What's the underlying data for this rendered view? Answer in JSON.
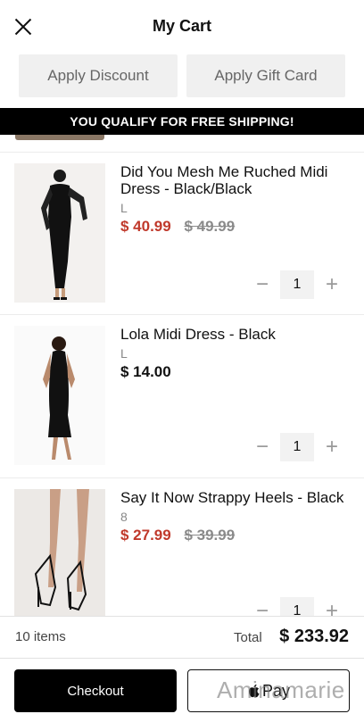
{
  "header": {
    "title": "My Cart"
  },
  "actions": {
    "discount_label": "Apply Discount",
    "gift_card_label": "Apply Gift Card"
  },
  "banner": {
    "text": "YOU QUALIFY FOR FREE SHIPPING!"
  },
  "items": [
    {
      "name": "Did You Mesh Me Ruched Midi Dress - Black/Black",
      "size": "L",
      "price": "$ 40.99",
      "original_price": "$ 49.99",
      "quantity": "1"
    },
    {
      "name": "Lola Midi Dress - Black",
      "size": "L",
      "price": "$ 14.00",
      "quantity": "1"
    },
    {
      "name": "Say It Now Strappy Heels - Black",
      "size": "8",
      "price": "$ 27.99",
      "original_price": "$ 39.99",
      "quantity": "1"
    }
  ],
  "qty_controls": {
    "minus": "−",
    "plus": "+"
  },
  "summary": {
    "items_count": "10 items",
    "total_label": "Total",
    "total_value": "$ 233.92"
  },
  "footer": {
    "checkout_label": "Checkout",
    "applepay_label": "Pay",
    "watermark": "Aminamarie"
  },
  "colors": {
    "sale_price": "#c0392b",
    "banner_bg": "#000000",
    "checkout_bg": "#000000"
  }
}
